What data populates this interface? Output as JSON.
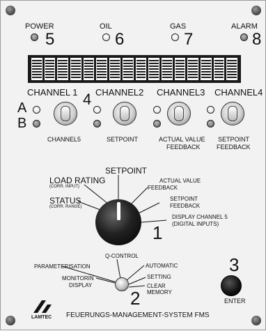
{
  "indicators": [
    {
      "label": "POWER",
      "number": "5"
    },
    {
      "label": "OIL",
      "number": "6"
    },
    {
      "label": "GAS",
      "number": "7"
    },
    {
      "label": "ALARM",
      "number": "8"
    }
  ],
  "channels": {
    "top": [
      "CHANNEL 1",
      "CHANNEL2",
      "CHANNEL3",
      "CHANNEL4"
    ],
    "row_a": "A",
    "row_b": "B",
    "group_number": "4",
    "bottom": [
      "CHANNEL5",
      "SETPOINT",
      "ACTUAL VALUE",
      "FEEDBACK",
      "SETPOINT",
      "FEEDBACK"
    ]
  },
  "rotary": {
    "number": "1",
    "setpoint": "SETPOINT",
    "load_rating": "LOAD RATING",
    "load_rating_sub": "(CORR. INPUT)",
    "status": "STATUS",
    "status_sub": "(CORR. RANGE)",
    "actual_value": "ACTUAL VALUE",
    "actual_value_2": "FEEDBACK",
    "setpoint_fb": "SETPOINT",
    "setpoint_fb_2": "FEEDBACK",
    "display_ch5": "DISPLAY CHANNEL 5",
    "display_ch5_2": "(DIGITAL INPUTS)"
  },
  "mode_selector": {
    "number": "2",
    "q_control": "Q-CONTROL",
    "parameterisation": "PARAMETERISATION",
    "automatic": "AUTOMATIC",
    "monitorin": "MONITORIN",
    "display": "DISPLAY",
    "setting": "SETTING",
    "clear": "CLEAR",
    "memory": "MEMORY"
  },
  "enter": {
    "number": "3",
    "label": "ENTER"
  },
  "footer": {
    "brand": "LAMTEC",
    "title": "FEUERUNGS-MANAGEMENT-SYSTEM FMS"
  }
}
